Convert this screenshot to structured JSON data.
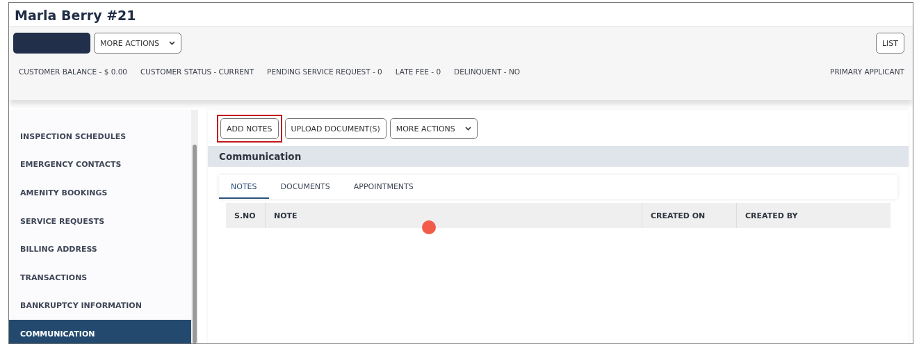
{
  "window": {
    "title": "Marla Berry #21"
  },
  "header": {
    "primary_button": {
      "kind": "blank"
    },
    "more_actions": "MORE ACTIONS",
    "list_button": "LIST",
    "stats": [
      "CUSTOMER BALANCE - $ 0.00",
      "CUSTOMER STATUS - CURRENT",
      "PENDING SERVICE REQUEST - 0",
      "LATE FEE - 0",
      "DELINQUENT - NO"
    ],
    "role": "PRIMARY APPLICANT"
  },
  "sidebar": {
    "items": [
      {
        "label": "INSPECTION SCHEDULES",
        "selected": false
      },
      {
        "label": "EMERGENCY CONTACTS",
        "selected": false
      },
      {
        "label": "AMENITY BOOKINGS",
        "selected": false
      },
      {
        "label": "SERVICE REQUESTS",
        "selected": false
      },
      {
        "label": "BILLING ADDRESS",
        "selected": false
      },
      {
        "label": "TRANSACTIONS",
        "selected": false
      },
      {
        "label": "BANKRUPTCY INFORMATION",
        "selected": false
      },
      {
        "label": "COMMUNICATION",
        "selected": true
      }
    ]
  },
  "toolbar": {
    "buttons": [
      {
        "label": "ADD NOTES",
        "highlighted": true,
        "dropdown": false
      },
      {
        "label": "UPLOAD DOCUMENT(S)",
        "highlighted": false,
        "dropdown": false
      },
      {
        "label": "MORE ACTIONS",
        "highlighted": false,
        "dropdown": true
      }
    ]
  },
  "section": {
    "title": "Communication",
    "tabs": [
      {
        "label": "NOTES",
        "selected": true
      },
      {
        "label": "DOCUMENTS",
        "selected": false
      },
      {
        "label": "APPOINTMENTS",
        "selected": false
      }
    ],
    "table": {
      "columns": [
        "S.NO",
        "NOTE",
        "CREATED ON",
        "CREATED BY"
      ]
    }
  }
}
